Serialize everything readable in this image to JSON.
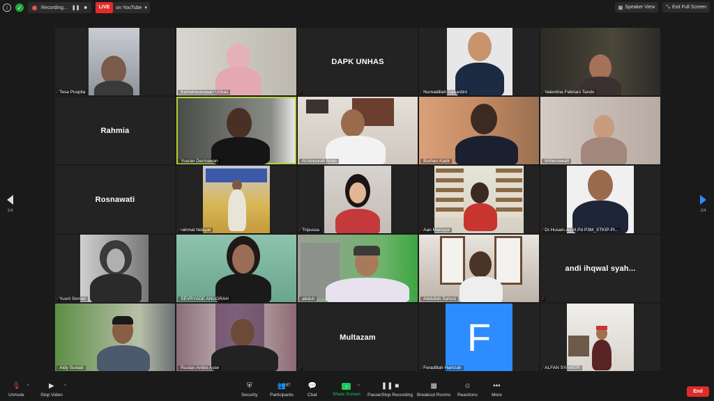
{
  "topbar": {
    "recording_label": "Recording...",
    "live_label": "LIVE",
    "youtube_label": "on YouTube",
    "speaker_view_label": "Speaker View",
    "exit_fullscreen_label": "Exit Full Screen"
  },
  "pagination": {
    "left": "1/4",
    "right": "1/4"
  },
  "participants": [
    {
      "name": "Tesa Puspita",
      "has_video": true
    },
    {
      "name": "Kemahasiswaan Unhas",
      "has_video": true
    },
    {
      "name": "DAPK UNHAS",
      "display_name": "DAPK UNHAS",
      "has_video": false
    },
    {
      "name": "Nurnadillah Gabardini",
      "has_video": true
    },
    {
      "name": "Valentina Febriani Tando",
      "has_video": true
    },
    {
      "name": "Rahmia",
      "display_name": "Rahmia",
      "has_video": false
    },
    {
      "name": "Yusran Darmawan",
      "has_video": true,
      "active_speaker": true
    },
    {
      "name": "Al Amsurah Arsin",
      "has_video": true
    },
    {
      "name": "Burhan Kadir",
      "has_video": true
    },
    {
      "name": "Imhemawati",
      "has_video": true
    },
    {
      "name": "Rosnawati",
      "display_name": "Rosnawati",
      "has_video": false
    },
    {
      "name": "rahmat hidayat",
      "has_video": true
    },
    {
      "name": "Tripussa",
      "has_video": true
    },
    {
      "name": "Aan Mansyur",
      "has_video": true
    },
    {
      "name": "Dr.Husain.As.M.Pd P3M_STKIP-Pl...",
      "has_video": true
    },
    {
      "name": "Yusril Sirman",
      "has_video": true
    },
    {
      "name": "SEVRYADE ANUGRAH",
      "has_video": true
    },
    {
      "name": "abduh",
      "has_video": true
    },
    {
      "name": "Abdullah Sanusi",
      "has_video": true
    },
    {
      "name": "andi ihqwal syah...",
      "display_name": "andi ihqwal syah...",
      "has_video": false
    },
    {
      "name": "Aidy Suriadi",
      "has_video": true
    },
    {
      "name": "Rustan Ambo Asse",
      "has_video": true
    },
    {
      "name": "Multazam",
      "display_name": "Multazam",
      "has_video": false
    },
    {
      "name": "Feradillah Hamzah",
      "has_video": true,
      "avatar_letter": "F"
    },
    {
      "name": "ALFAN SYAMSIR",
      "has_video": true
    }
  ],
  "toolbar": {
    "unmute": "Unmute",
    "stop_video": "Stop Video",
    "security": "Security",
    "participants": "Participants",
    "participants_count": "97",
    "chat": "Chat",
    "share_screen": "Share Screen",
    "pause_stop_recording": "Pause/Stop Recording",
    "breakout_rooms": "Breakout Rooms",
    "reactions": "Reactions",
    "more": "More",
    "end": "End"
  },
  "colors": {
    "live_red": "#e02b2b",
    "share_green": "#22c55e",
    "active_border": "#b5d43a",
    "avatar_blue": "#2d8cff"
  }
}
